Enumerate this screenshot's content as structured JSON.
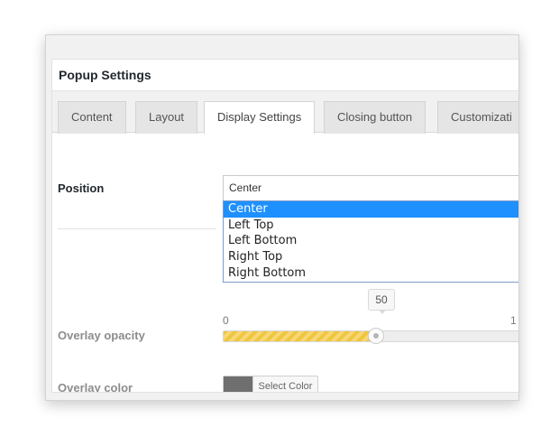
{
  "panel": {
    "title": "Popup Settings"
  },
  "tabs": [
    {
      "label": "Content"
    },
    {
      "label": "Layout"
    },
    {
      "label": "Display Settings"
    },
    {
      "label": "Closing button"
    },
    {
      "label": "Customizati"
    }
  ],
  "position": {
    "label": "Position",
    "selected": "Center",
    "options": [
      "Center",
      "Left Top",
      "Left Bottom",
      "Right Top",
      "Right Bottom"
    ]
  },
  "overlay_opacity": {
    "label": "Overlay opacity",
    "value": "50",
    "min_label": "0",
    "max_label": "1",
    "fraction": 0.5
  },
  "overlay_color": {
    "label": "Overlay color",
    "button_label": "Select Color",
    "swatch_color": "#6f6f6f"
  },
  "colors": {
    "dropdown_highlight": "#1e90ff",
    "slider_fill": "#f7d777"
  }
}
